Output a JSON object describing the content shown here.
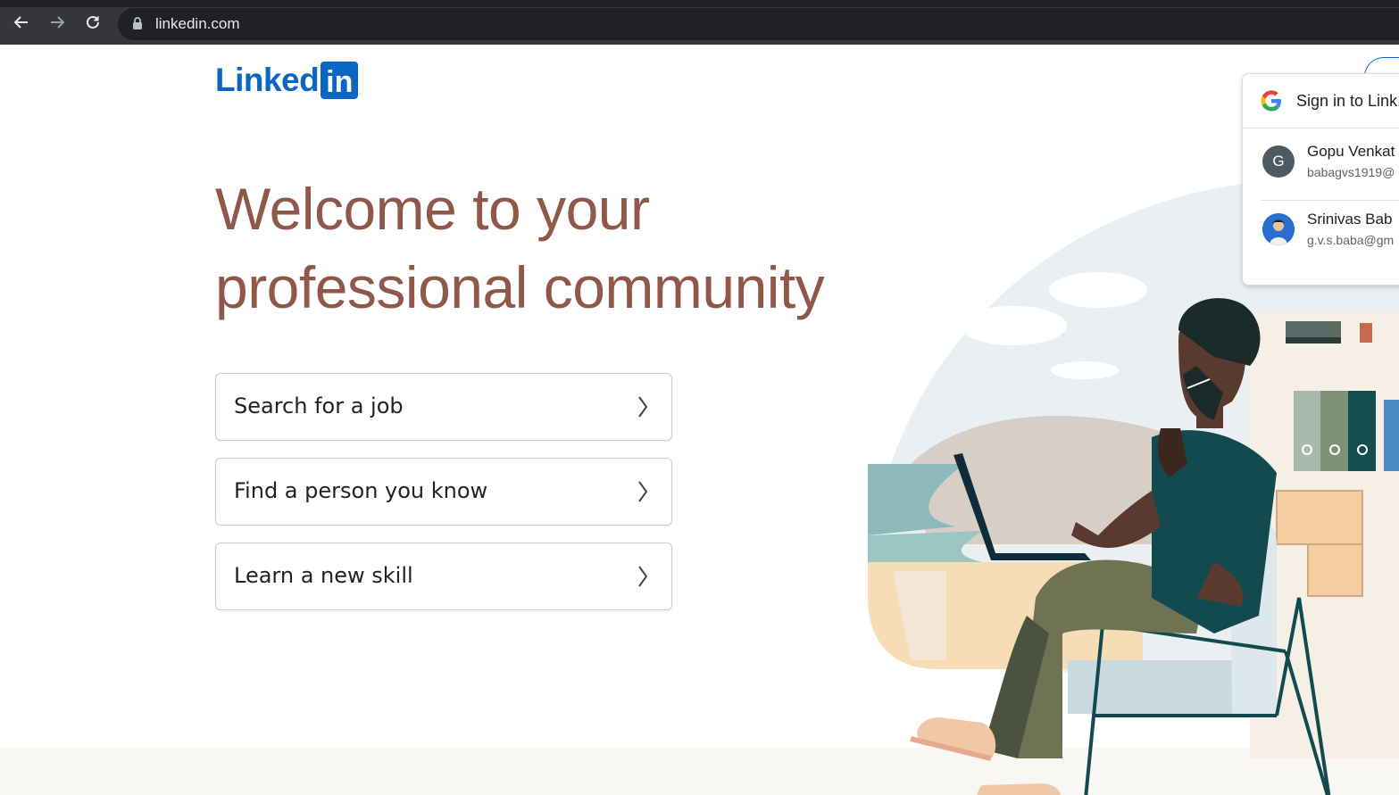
{
  "browser": {
    "url": "linkedin.com",
    "icons": [
      "back-arrow-icon",
      "forward-arrow-icon",
      "reload-icon",
      "lock-icon"
    ]
  },
  "logo": {
    "word": "Linked",
    "box": "in"
  },
  "hero": {
    "line1": "Welcome to your",
    "line2": "professional community"
  },
  "actions": [
    {
      "label": "Search for a job"
    },
    {
      "label": "Find a person you know"
    },
    {
      "label": "Learn a new skill"
    }
  ],
  "google_signin": {
    "title": "Sign in to Link",
    "accounts": [
      {
        "initial": "G",
        "name": "Gopu Venkat",
        "email": "babagvs1919@",
        "avatar_color": "#4b5a63"
      },
      {
        "initial": "",
        "name": "Srinivas Bab",
        "email": "g.v.s.baba@gm",
        "avatar_color": "#1e63c4"
      }
    ]
  },
  "colors": {
    "brand": "#0a66c2",
    "hero_text": "#8f5849",
    "chrome_bar": "#35363a"
  }
}
